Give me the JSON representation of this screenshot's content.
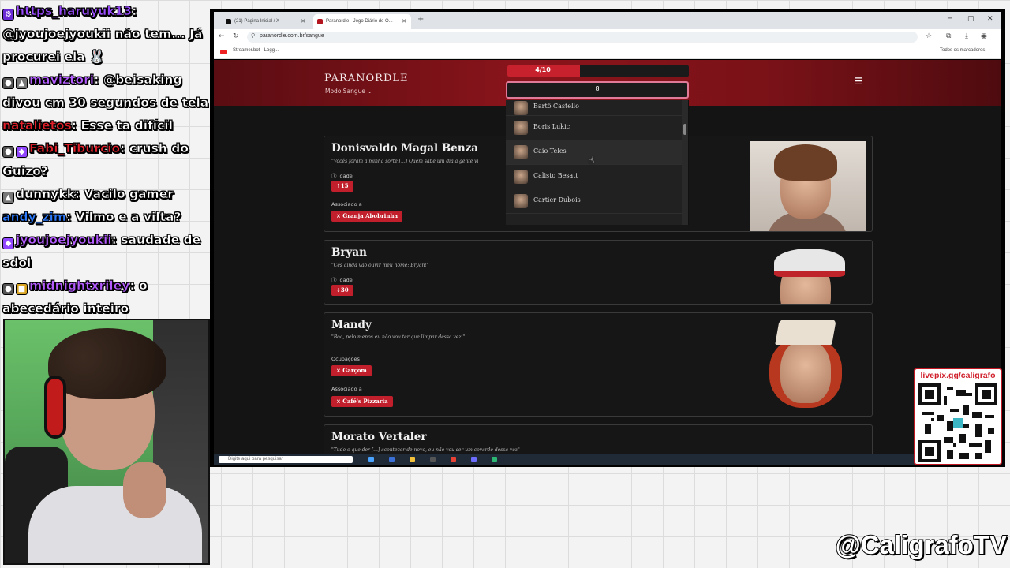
{
  "chat": [
    {
      "user": "https_haruyuk13",
      "user_color": "#9b4dff",
      "text": "",
      "badges": [
        "B"
      ]
    },
    {
      "user": "",
      "user_color": "#ffffff",
      "text": "@jyoujoejyoukii não tem... Já procurei ela 🐰",
      "badges": []
    },
    {
      "user": "maviztori",
      "user_color": "#b45cff",
      "text": "@beisaking divou cm 30 segundos de tela",
      "badges": [
        "B",
        "B"
      ]
    },
    {
      "user": "natalietos",
      "user_color": "#e0202a",
      "text": "Esse ta difícil",
      "badges": []
    },
    {
      "user": "Fabi_Tiburcio",
      "user_color": "#e0202a",
      "text": "crush do Guizo?",
      "badges": [
        "B",
        "B"
      ]
    },
    {
      "user": "dunnykk",
      "user_color": "#ffffff",
      "text": "Vacilo gamer",
      "badges": [
        "B"
      ]
    },
    {
      "user": "andy_zim",
      "user_color": "#2d7bff",
      "text": "Vilmo e a vilta?",
      "badges": []
    },
    {
      "user": "jyoujoejyoukii",
      "user_color": "#b45cff",
      "text": "saudade de sdol",
      "badges": [
        "B"
      ]
    },
    {
      "user": "midnightxriley",
      "user_color": "#b45cff",
      "text": "o abecedário inteiro",
      "badges": [
        "B",
        "B"
      ]
    }
  ],
  "browser": {
    "tabs": [
      {
        "label": "(21) Página Inicial / X"
      },
      {
        "label": "Paranordle - Jogo Diário de O..."
      }
    ],
    "url": "paranordle.com.br/sangue",
    "bookmarks": [
      "Streamer.bot - Logg...",
      "Todos os marcadores"
    ]
  },
  "game": {
    "logo": "PARANORDLE",
    "mode": "Modo Sangue",
    "progress": {
      "label": "4/10",
      "value": 0.4
    },
    "search_value": "8",
    "dropdown": [
      "Bartô Castello",
      "Boris Lukic",
      "Caio Teles",
      "Calisto Besatt",
      "Cartier Dubois"
    ],
    "cards": [
      {
        "name": "Donisvaldo Magal Benza",
        "quote": "\"Vocês foram a minha sorte [...] Quem sabe um dia a gente vi",
        "age_label": "Idade",
        "age_value": "↑15",
        "assoc_label": "Associado a",
        "assoc_value": "× Granja Abobrinha"
      },
      {
        "name": "Bryan",
        "quote": "\"Cês ainda vão ouvir meu nome: Bryan!\"",
        "age_label": "Idade",
        "age_value": "↓30"
      },
      {
        "name": "Mandy",
        "quote": "\"Boa, pelo menos eu não vou ter que limpar dessa vez.\"",
        "occ_label": "Ocupações",
        "occ_value": "× Garçom",
        "assoc_label": "Associado a",
        "assoc_value": "× Café's Pizzaria"
      },
      {
        "name": "Morato Vertaler",
        "quote": "\"Tudo o que der [...] acontecer de novo, eu não vou ser um covarde dessa vez\""
      }
    ]
  },
  "taskbar": {
    "search_placeholder": "Digite aqui para pesquisar"
  },
  "overlay": {
    "livepix": "livepix.gg/caligrafo",
    "handle": "@CaligrafoTV"
  }
}
